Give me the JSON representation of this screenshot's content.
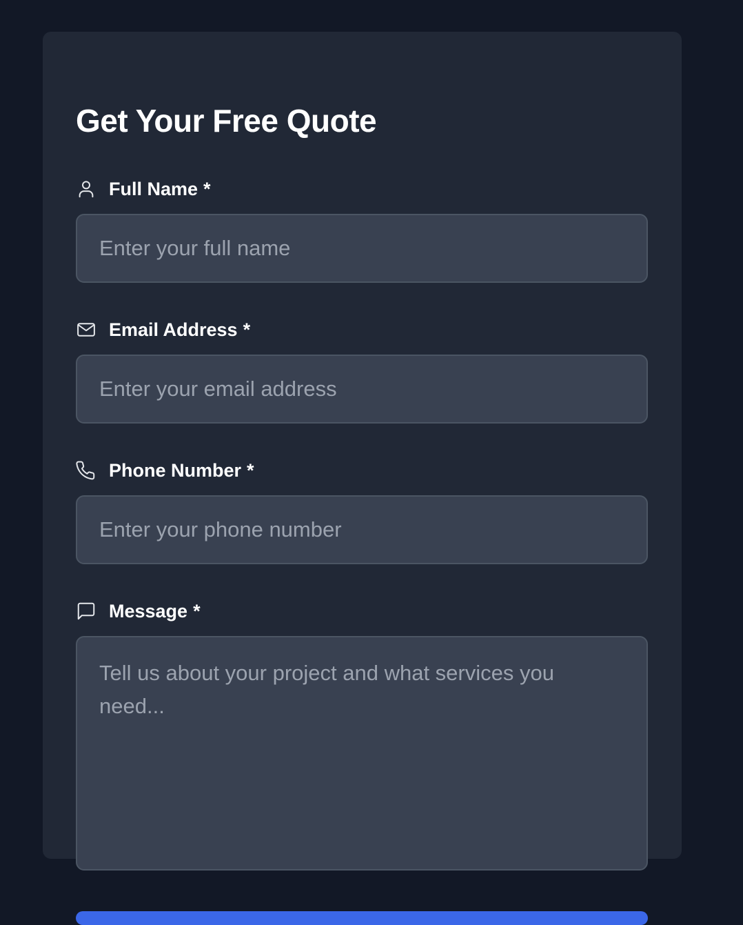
{
  "form": {
    "title": "Get Your Free Quote",
    "fields": [
      {
        "icon": "user-icon",
        "label": "Full Name",
        "required": "*",
        "placeholder": "Enter your full name",
        "value": ""
      },
      {
        "icon": "mail-icon",
        "label": "Email Address",
        "required": "*",
        "placeholder": "Enter your email address",
        "value": ""
      },
      {
        "icon": "phone-icon",
        "label": "Phone Number",
        "required": "*",
        "placeholder": "Enter your phone number",
        "value": ""
      },
      {
        "icon": "message-icon",
        "label": "Message",
        "required": "*",
        "placeholder": "Tell us about your project and what services you need...",
        "value": ""
      }
    ]
  },
  "colors": {
    "page_background": "#121826",
    "card_background": "#212836",
    "input_background": "#394151",
    "input_border": "#4b5563",
    "placeholder_text": "#9ca3af",
    "heading_text": "#ffffff",
    "accent": "#3b67e8"
  }
}
